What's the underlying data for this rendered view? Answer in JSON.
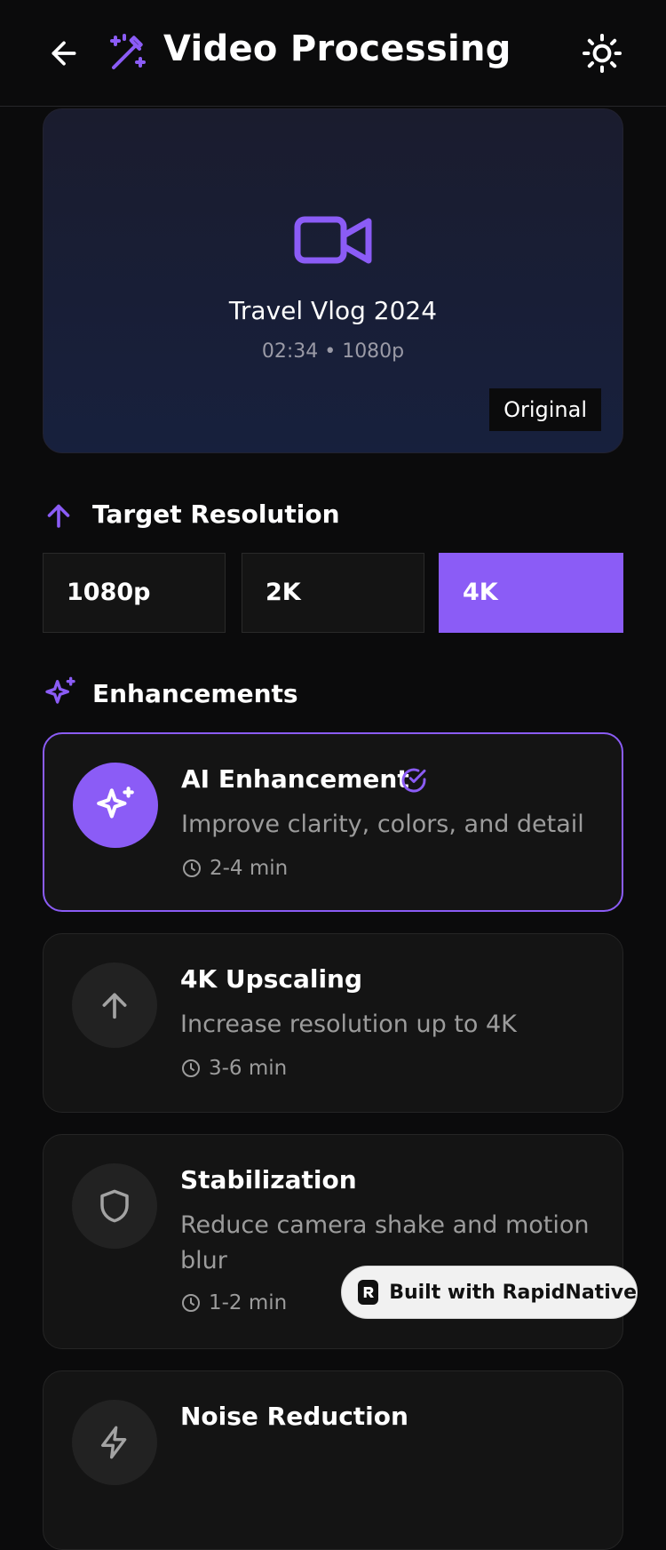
{
  "header": {
    "title": "Video Processing",
    "back_icon": "arrow-left-icon",
    "title_icon": "magic-wand-icon",
    "theme_icon": "sun-icon"
  },
  "preview": {
    "video_name": "Travel Vlog 2024",
    "video_meta": "02:34 • 1080p",
    "badge": "Original",
    "icon": "video-camera-icon"
  },
  "resolution": {
    "title": "Target Resolution",
    "icon": "arrow-up-icon",
    "options": [
      "1080p",
      "2K",
      "4K"
    ],
    "selected": "4K"
  },
  "enhancements": {
    "title": "Enhancements",
    "icon": "sparkles-icon",
    "items": [
      {
        "title": "AI Enhancement",
        "description": "Improve clarity, colors, and detail",
        "time": "2-4 min",
        "selected": true,
        "icon": "sparkles-icon"
      },
      {
        "title": "4K Upscaling",
        "description": "Increase resolution up to 4K",
        "time": "3-6 min",
        "selected": false,
        "icon": "arrow-up-icon"
      },
      {
        "title": "Stabilization",
        "description": "Reduce camera shake and motion blur",
        "time": "1-2 min",
        "selected": false,
        "icon": "shield-icon"
      },
      {
        "title": "Noise Reduction",
        "selected": false,
        "icon": "zap-icon"
      }
    ]
  },
  "badge_built": "Built with RapidNative",
  "colors": {
    "accent": "#8b5cf6",
    "background": "#0b0b0c",
    "card": "#141414",
    "muted_text": "#9c9c9c"
  }
}
